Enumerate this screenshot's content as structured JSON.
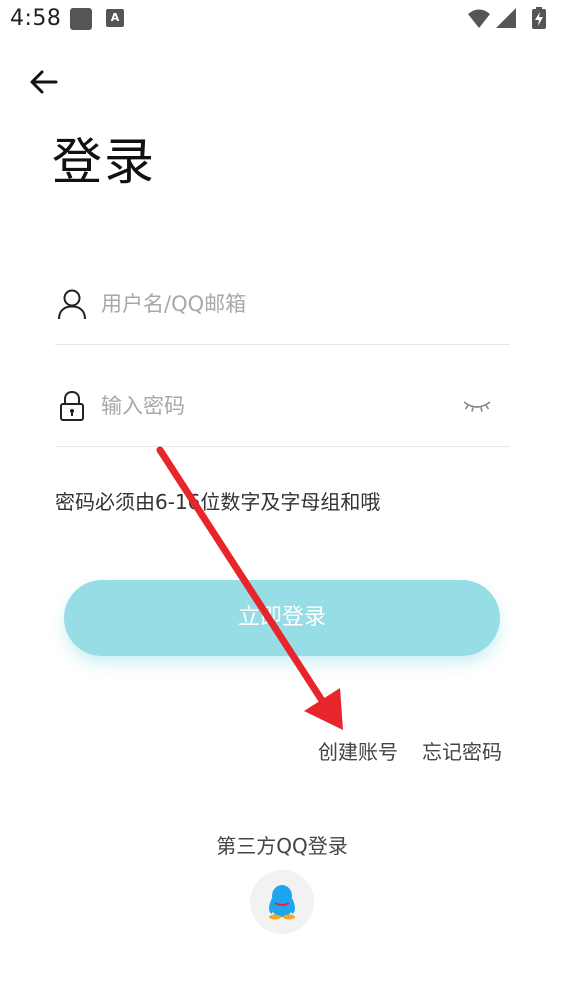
{
  "status_bar": {
    "time": "4:58",
    "notification_icons": [
      "square-notification-icon",
      "a-notification-icon"
    ],
    "a_icon_glyph": "A",
    "system_icons": [
      "wifi-icon",
      "cell-signal-icon",
      "battery-charging-icon"
    ]
  },
  "header": {
    "back_icon": "arrow-left-icon",
    "title": "登录"
  },
  "form": {
    "username": {
      "icon": "user-icon",
      "placeholder": "用户名/QQ邮箱",
      "value": ""
    },
    "password": {
      "icon": "lock-icon",
      "placeholder": "输入密码",
      "value": "",
      "toggle_icon": "eye-closed-icon"
    },
    "hint": "密码必须由6-16位数字及字母组和哦"
  },
  "actions": {
    "login_label": "立即登录",
    "create_account_label": "创建账号",
    "forgot_password_label": "忘记密码"
  },
  "third_party": {
    "label": "第三方QQ登录",
    "qq_icon": "qq-penguin-icon"
  },
  "annotation": {
    "icon": "red-arrow-annotation",
    "color": "#e8252b"
  },
  "colors": {
    "accent": "#97dde6",
    "qq_blue": "#1ea5f0",
    "text_primary": "#111111",
    "placeholder": "#a8a8a8"
  }
}
